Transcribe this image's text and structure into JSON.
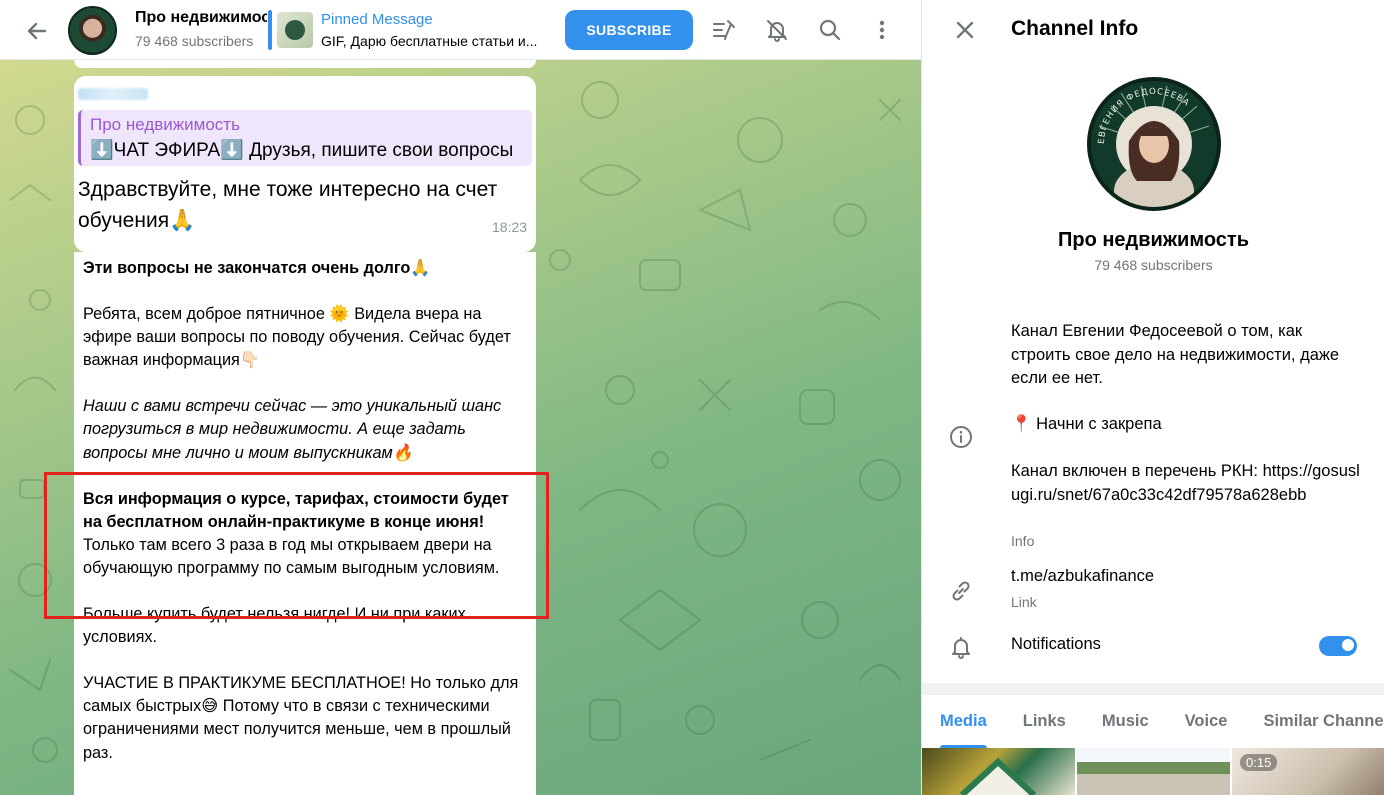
{
  "header": {
    "title": "Про недвижимость",
    "subscribers": "79 468 subscribers",
    "pinned_label": "Pinned Message",
    "pinned_text": "GIF, Дарю бесплатные статьи и...",
    "subscribe_label": "SUBSCRIBE"
  },
  "reply_message": {
    "quote_name": "Про недвижимость",
    "quote_text": "⬇️ЧАТ ЭФИРА⬇️ Друзья, пишите свои вопросы",
    "text": "Здравствуйте, мне тоже интересно на счет обучения🙏",
    "time": "18:23"
  },
  "post": {
    "p1": "Эти вопросы не закончатся очень долго🙏",
    "p2": "Ребята, всем доброе пятничное 🌞 Видела вчера на эфире ваши вопросы по поводу обучения. Сейчас будет важная информация👇🏻",
    "p3": "Наши с вами встречи сейчас — это уникальный шанс погрузиться в мир недвижимости. А еще задать вопросы мне лично и моим выпускникам🔥",
    "p4_bold": "Вся информация о курсе, тарифах, стоимости будет на бесплатном онлайн-практикуме в конце июня!",
    "p4_rest": "Только там всего 3 раза в год мы открываем двери на обучающую программу по самым выгодным условиям.",
    "p5": "Больше купить будет нельзя нигде! И ни при каких условиях.",
    "p6": "УЧАСТИЕ В ПРАКТИКУМЕ БЕСПЛАТНОЕ! Но только для самых быстрых😅 Потому что в связи с техническими ограничениями мест получится меньше, чем в прошлый раз."
  },
  "info_panel": {
    "title": "Channel Info",
    "name": "Про недвижимость",
    "subscribers": "79 468 subscribers",
    "avatar_ring_text": "ЕВГЕНИЯ ФЕДОСЕЕВА",
    "description": "Канал Евгении Федосеевой о том, как строить свое дело на недвижимости, даже если ее нет.",
    "pin_note": "📍 Начни с закрепа",
    "rkn_text": "Канал включен в перечень РКН: https://gosuslugi.ru/snet/67a0c33c42df79578a628ebb",
    "info_label": "Info",
    "link": "t.me/azbukafinance",
    "link_label": "Link",
    "notifications_label": "Notifications",
    "notifications_on": true,
    "tabs": [
      "Media",
      "Links",
      "Music",
      "Voice",
      "Similar Channels"
    ],
    "active_tab": "Media",
    "media": [
      {
        "duration": ""
      },
      {
        "duration": ""
      },
      {
        "duration": "0:15"
      }
    ]
  },
  "colors": {
    "accent": "#3390ec",
    "highlight_box": "#e3221b",
    "quote_accent": "#9b59d0"
  },
  "icons": [
    "back-arrow-icon",
    "filter-icon",
    "bell-off-icon",
    "search-icon",
    "more-vertical-icon",
    "close-icon",
    "info-icon",
    "link-icon",
    "bell-icon"
  ]
}
